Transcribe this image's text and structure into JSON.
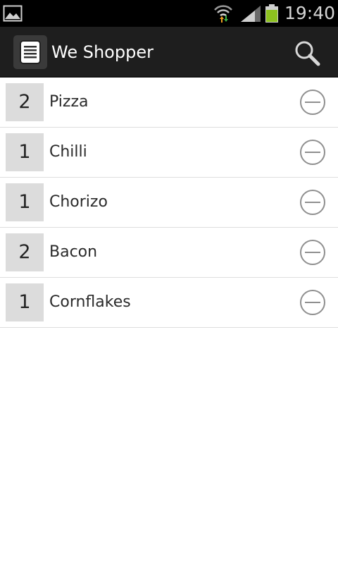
{
  "status_bar": {
    "time": "19:40",
    "icons": [
      "gallery-icon",
      "wifi-icon",
      "signal-icon",
      "battery-icon"
    ],
    "battery_color": "#8dc21f"
  },
  "action_bar": {
    "title": "We Shopper",
    "app_icon": "list-icon",
    "action_icon": "search-icon",
    "background": "#1e1e1e"
  },
  "shopping_list": {
    "items": [
      {
        "qty": "2",
        "name": "Pizza"
      },
      {
        "qty": "1",
        "name": "Chilli"
      },
      {
        "qty": "1",
        "name": "Chorizo"
      },
      {
        "qty": "2",
        "name": "Bacon"
      },
      {
        "qty": "1",
        "name": "Cornflakes"
      }
    ],
    "item_action_icon": "remove-circle-icon"
  }
}
